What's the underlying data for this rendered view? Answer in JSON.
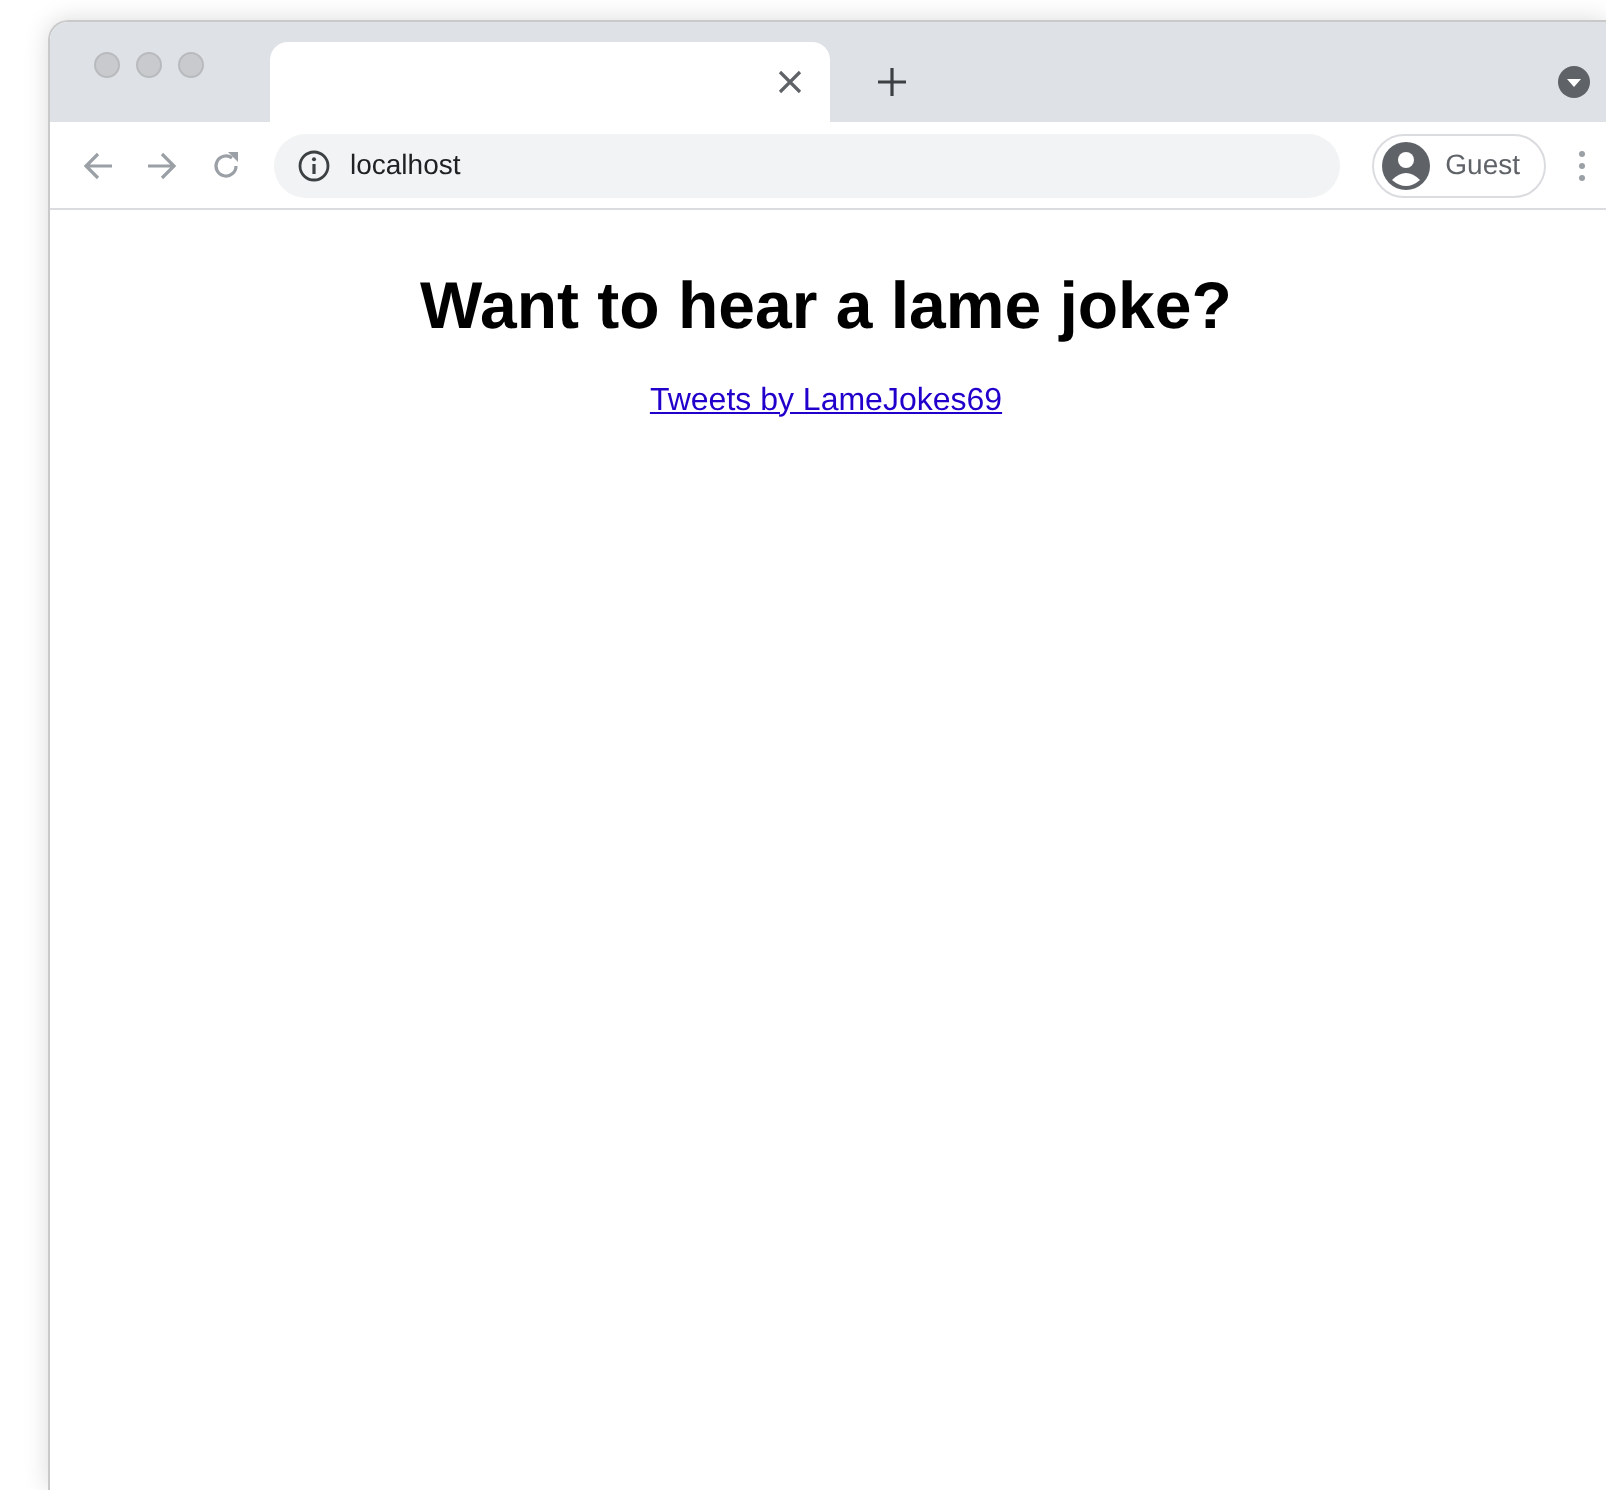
{
  "browser": {
    "address": "localhost",
    "profile": "Guest"
  },
  "page": {
    "heading": "Want to hear a lame joke?",
    "link": "Tweets by LameJokes69"
  }
}
